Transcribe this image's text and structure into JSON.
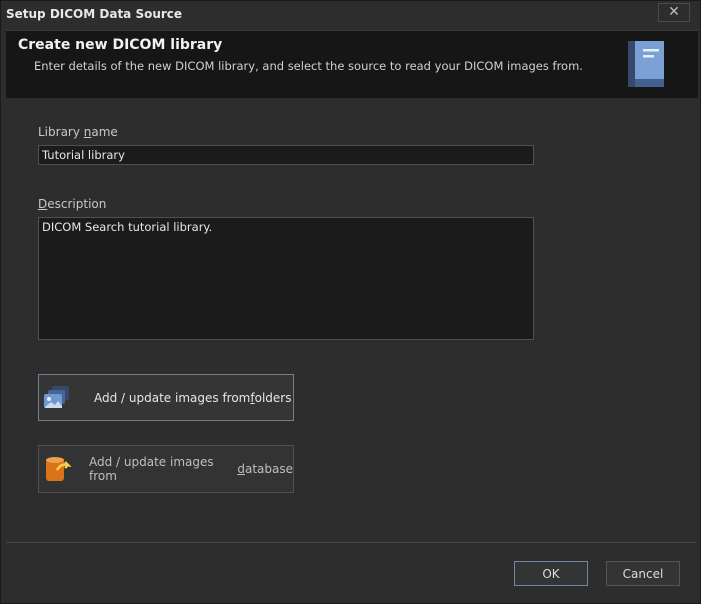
{
  "window": {
    "title": "Setup DICOM Data Source",
    "close_glyph": "✕"
  },
  "header": {
    "title": "Create new DICOM library",
    "subtitle": "Enter details of the new DICOM library, and select the source to read your DICOM images from.",
    "icon": "book-icon"
  },
  "form": {
    "library_name_label_pre": "Library ",
    "library_name_label_underlined": "n",
    "library_name_label_post": "ame",
    "library_name_value": "Tutorial library",
    "description_label_underlined": "D",
    "description_label_post": "escription",
    "description_value": "DICOM Search tutorial library."
  },
  "actions": {
    "folders_pre": "Add / update images from ",
    "folders_underlined": "f",
    "folders_post": "olders",
    "folders_icon": "images-folder-icon",
    "database_pre": "Add / update images from ",
    "database_underlined": "d",
    "database_post": "atabase",
    "database_icon": "database-icon"
  },
  "buttons": {
    "ok": "OK",
    "cancel": "Cancel"
  },
  "colors": {
    "background": "#2d2d2d",
    "header": "#161616",
    "accent": "#6f87a1"
  }
}
